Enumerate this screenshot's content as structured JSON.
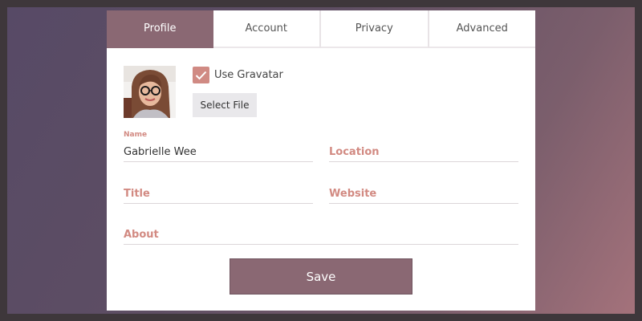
{
  "tabs": [
    {
      "label": "Profile",
      "active": true
    },
    {
      "label": "Account",
      "active": false
    },
    {
      "label": "Privacy",
      "active": false
    },
    {
      "label": "Advanced",
      "active": false
    }
  ],
  "avatar": {
    "alt": "profile photo"
  },
  "gravatar": {
    "label": "Use Gravatar",
    "checked": true
  },
  "select_file": {
    "label": "Select File"
  },
  "fields": {
    "name": {
      "label": "Name",
      "value": "Gabrielle Wee"
    },
    "location": {
      "placeholder": "Location"
    },
    "title": {
      "placeholder": "Title"
    },
    "website": {
      "placeholder": "Website"
    },
    "about": {
      "placeholder": "About"
    }
  },
  "save": {
    "label": "Save"
  },
  "colors": {
    "accent": "#8a6873",
    "label": "#d28a82",
    "checkbox": "#d08a83"
  }
}
